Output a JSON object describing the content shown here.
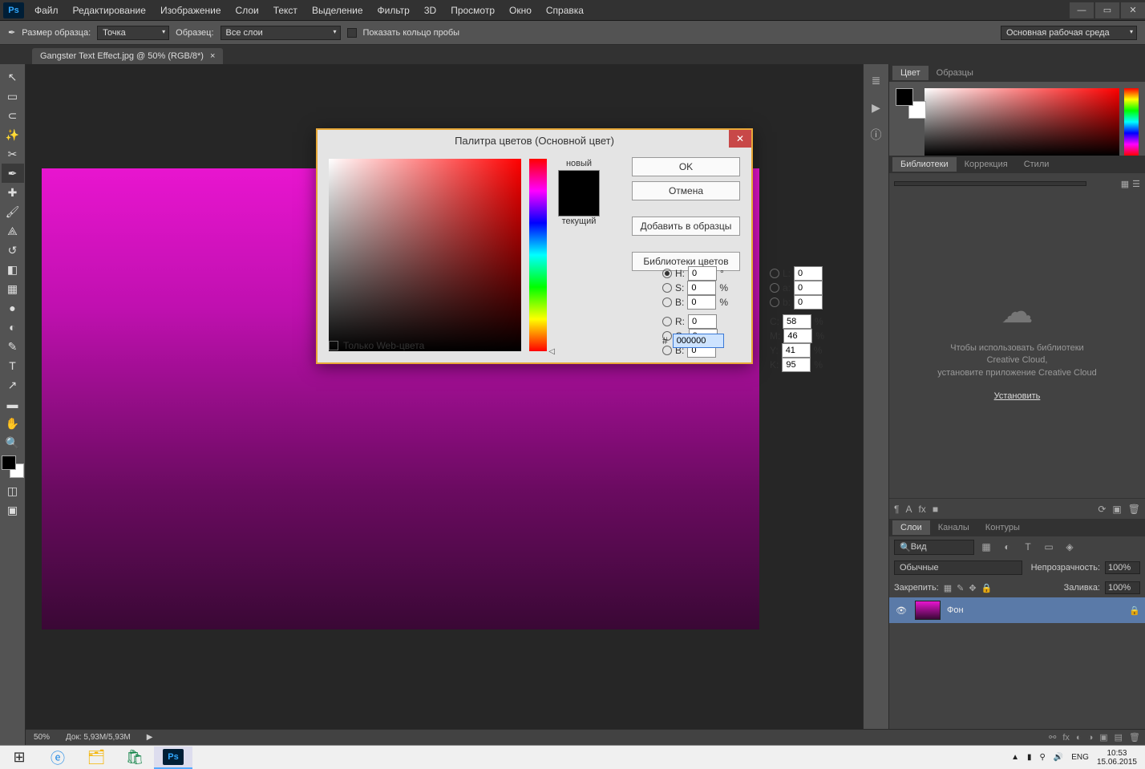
{
  "menu": [
    "Файл",
    "Редактирование",
    "Изображение",
    "Слои",
    "Текст",
    "Выделение",
    "Фильтр",
    "3D",
    "Просмотр",
    "Окно",
    "Справка"
  ],
  "options": {
    "sample_size_label": "Размер образца:",
    "sample_size_value": "Точка",
    "sample_label": "Образец:",
    "sample_value": "Все слои",
    "show_ring": "Показать кольцо пробы",
    "workspace": "Основная рабочая среда"
  },
  "doctab": {
    "title": "Gangster Text Effect.jpg @ 50% (RGB/8*)"
  },
  "status": {
    "zoom": "50%",
    "doc": "Док: 5,93M/5,93M"
  },
  "panels": {
    "color_tabs": [
      "Цвет",
      "Образцы"
    ],
    "lib_tabs": [
      "Библиотеки",
      "Коррекция",
      "Стили"
    ],
    "lib_msg_l1": "Чтобы использовать библиотеки",
    "lib_msg_l2": "Creative Cloud,",
    "lib_msg_l3": "установите приложение Creative Cloud",
    "install": "Установить",
    "layer_tabs": [
      "Слои",
      "Каналы",
      "Контуры"
    ],
    "layer_filter": "Вид",
    "blend_mode": "Обычные",
    "opacity_lbl": "Непрозрачность:",
    "opacity_val": "100%",
    "lock_lbl": "Закрепить:",
    "fill_lbl": "Заливка:",
    "fill_val": "100%",
    "layer_name": "Фон"
  },
  "dialog": {
    "title": "Палитра цветов (Основной цвет)",
    "new": "новый",
    "current": "текущий",
    "ok": "OK",
    "cancel": "Отмена",
    "add_swatch": "Добавить в образцы",
    "color_libs": "Библиотеки цветов",
    "web_only": "Только Web-цвета",
    "hex": "000000",
    "H": "0",
    "S": "0",
    "Bv": "0",
    "R": "0",
    "G": "0",
    "Bc": "0",
    "L": "0",
    "a": "0",
    "b": "0",
    "C": "58",
    "M": "46",
    "Y": "41",
    "K": "95"
  },
  "tray": {
    "lang": "ENG",
    "time": "10:53",
    "date": "15.06.2015"
  }
}
